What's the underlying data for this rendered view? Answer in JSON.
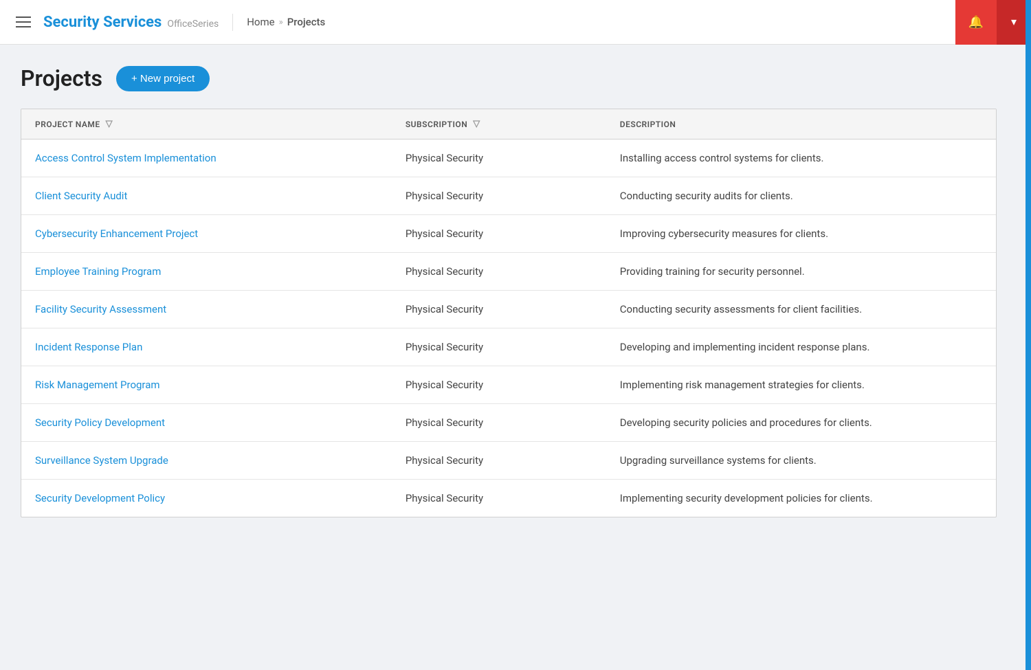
{
  "header": {
    "menu_label": "Menu",
    "brand_title": "Security Services",
    "brand_sub": "OfficeSeries",
    "nav_home": "Home",
    "nav_sep": "»",
    "nav_current": "Projects",
    "bell_icon": "🔔",
    "dropdown_icon": "▾"
  },
  "page": {
    "title": "Projects",
    "new_project_label": "+ New project"
  },
  "table": {
    "col_project": "PROJECT NAME",
    "col_subscription": "SUBSCRIPTION",
    "col_description": "DESCRIPTION",
    "rows": [
      {
        "name": "Access Control System Implementation",
        "subscription": "Physical Security",
        "description": "Installing access control systems for clients."
      },
      {
        "name": "Client Security Audit",
        "subscription": "Physical Security",
        "description": "Conducting security audits for clients."
      },
      {
        "name": "Cybersecurity Enhancement Project",
        "subscription": "Physical Security",
        "description": "Improving cybersecurity measures for clients."
      },
      {
        "name": "Employee Training Program",
        "subscription": "Physical Security",
        "description": "Providing training for security personnel."
      },
      {
        "name": "Facility Security Assessment",
        "subscription": "Physical Security",
        "description": "Conducting security assessments for client facilities."
      },
      {
        "name": "Incident Response Plan",
        "subscription": "Physical Security",
        "description": "Developing and implementing incident response plans."
      },
      {
        "name": "Risk Management Program",
        "subscription": "Physical Security",
        "description": "Implementing risk management strategies for clients."
      },
      {
        "name": "Security Policy Development",
        "subscription": "Physical Security",
        "description": "Developing security policies and procedures for clients."
      },
      {
        "name": "Surveillance System Upgrade",
        "subscription": "Physical Security",
        "description": "Upgrading surveillance systems for clients."
      },
      {
        "name": "Security Development Policy",
        "subscription": "Physical Security",
        "description": "Implementing security development policies for clients."
      }
    ]
  }
}
